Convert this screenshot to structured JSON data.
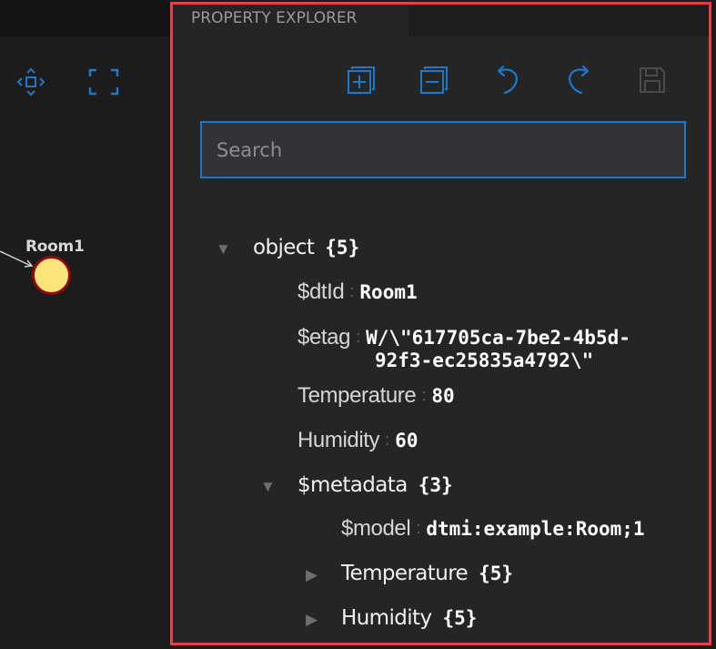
{
  "graph": {
    "node": {
      "label": "Room1"
    }
  },
  "panel": {
    "tab_label": "PROPERTY EXPLORER",
    "search": {
      "placeholder": "Search",
      "value": ""
    }
  },
  "tree": {
    "root": {
      "key": "object",
      "count": "{5}"
    },
    "dtId": {
      "key": "$dtId",
      "sep": ":",
      "value": "Room1"
    },
    "etag": {
      "key": "$etag",
      "sep": ":",
      "value_line1": "W/\\\"617705ca-7be2-4b5d-",
      "value_line2": "92f3-ec25835a4792\\\""
    },
    "temperature": {
      "key": "Temperature",
      "sep": ":",
      "value": "80"
    },
    "humidity": {
      "key": "Humidity",
      "sep": ":",
      "value": "60"
    },
    "metadata": {
      "key": "$metadata",
      "count": "{3}"
    },
    "model": {
      "key": "$model",
      "sep": ":",
      "value": "dtmi:example:Room;1"
    },
    "meta_temperature": {
      "key": "Temperature",
      "count": "{5}"
    },
    "meta_humidity": {
      "key": "Humidity",
      "count": "{5}"
    }
  },
  "icons": {
    "center": "move-center-icon",
    "fit": "fit-screen-icon",
    "expand_all": "expand-all-icon",
    "collapse_all": "collapse-all-icon",
    "undo": "undo-icon",
    "redo": "redo-icon",
    "save": "save-icon"
  },
  "colors": {
    "accent": "#1e78c8",
    "highlight_border": "#e54044",
    "node_fill": "#fde47a",
    "node_border": "#8c0c12",
    "panel_bg": "#252526"
  }
}
